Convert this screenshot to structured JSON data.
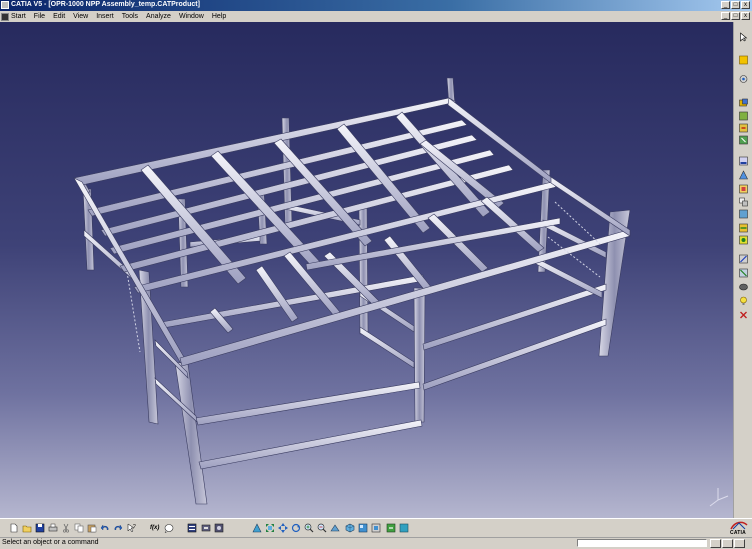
{
  "window": {
    "title": "CATIA V5 - [OPR-1000 NPP Assembly_temp.CATProduct]",
    "minimize_label": "_",
    "maximize_label": "□",
    "close_label": "x"
  },
  "menu": {
    "items": [
      "Start",
      "File",
      "Edit",
      "View",
      "Insert",
      "Tools",
      "Analyze",
      "Window",
      "Help"
    ]
  },
  "viewport": {
    "background_top": "#272a5e",
    "background_bottom": "#b5b6cf",
    "model": "steel-frame-structure",
    "compass_icon": "xyz-axis-icon"
  },
  "right_toolbar": {
    "icons": [
      "select-arrow-icon",
      "product-icon",
      "component-icon",
      "part-icon",
      "existing-component-icon",
      "replace-icon",
      "graph-tree-icon",
      "generate-numbering-icon",
      "selective-load-icon",
      "manage-representations-icon",
      "multi-instantiation-icon",
      "fast-multi-instantiation-icon",
      "reorder-icon",
      "constraint-icon",
      "fix-icon",
      "snap-icon",
      "smart-move-icon",
      "explode-icon",
      "stop-manipulation-icon",
      "bulb-icon",
      "update-icon"
    ]
  },
  "bottom_toolbar": {
    "icons": [
      "new-icon",
      "open-icon",
      "save-icon",
      "print-icon",
      "cut-icon",
      "copy-icon",
      "paste-icon",
      "undo-icon",
      "redo-icon",
      "whats-this-icon",
      "formula-icon",
      "catalog-icon",
      "knowledge-icon",
      "measure-icon",
      "apply-material-icon",
      "fly-mode-icon",
      "fit-all-icon",
      "pan-icon",
      "rotate-icon",
      "zoom-in-icon",
      "zoom-out-icon",
      "normal-view-icon",
      "iso-view-icon",
      "shading-icon",
      "hide-show-icon",
      "swap-visible-space-icon"
    ],
    "formula_label": "f(x)"
  },
  "statusbar": {
    "message": "Select an object or a command"
  },
  "logo": {
    "text": "CATIA"
  }
}
